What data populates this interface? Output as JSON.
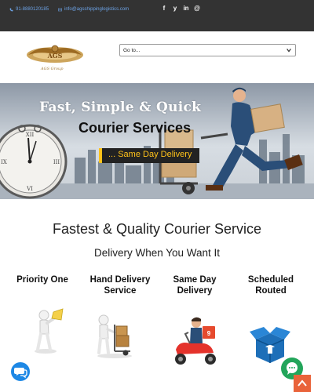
{
  "topbar": {
    "phone": "91-8880120185",
    "email": "info@agsshippinglogistics.com",
    "social_icons": [
      "facebook-icon",
      "twitter-icon",
      "linkedin-icon",
      "globe-icon"
    ],
    "social_glyphs": [
      "f",
      "y",
      "in",
      "@"
    ]
  },
  "header": {
    "logo_text": "AGS Group",
    "goto_select": {
      "selected": "Go to..."
    }
  },
  "hero": {
    "title_line1": "Fast, Simple & Quick",
    "title_line2": "Courier Services",
    "badge": "... Same Day Delivery"
  },
  "intro": {
    "headline": "Fastest & Quality Courier Service",
    "subline": "Delivery When You Want It"
  },
  "services": [
    {
      "title": "Priority One"
    },
    {
      "title": "Hand Delivery Service"
    },
    {
      "title": "Same Day Delivery"
    },
    {
      "title": "Scheduled Routed"
    }
  ],
  "colors": {
    "topbar_bg": "#333333",
    "link_blue": "#6da3e6",
    "badge_yellow": "#ffc21a",
    "chat_blue": "#1e88e5",
    "whatsapp_green": "#22a55a",
    "totop_orange": "#e9633a"
  }
}
